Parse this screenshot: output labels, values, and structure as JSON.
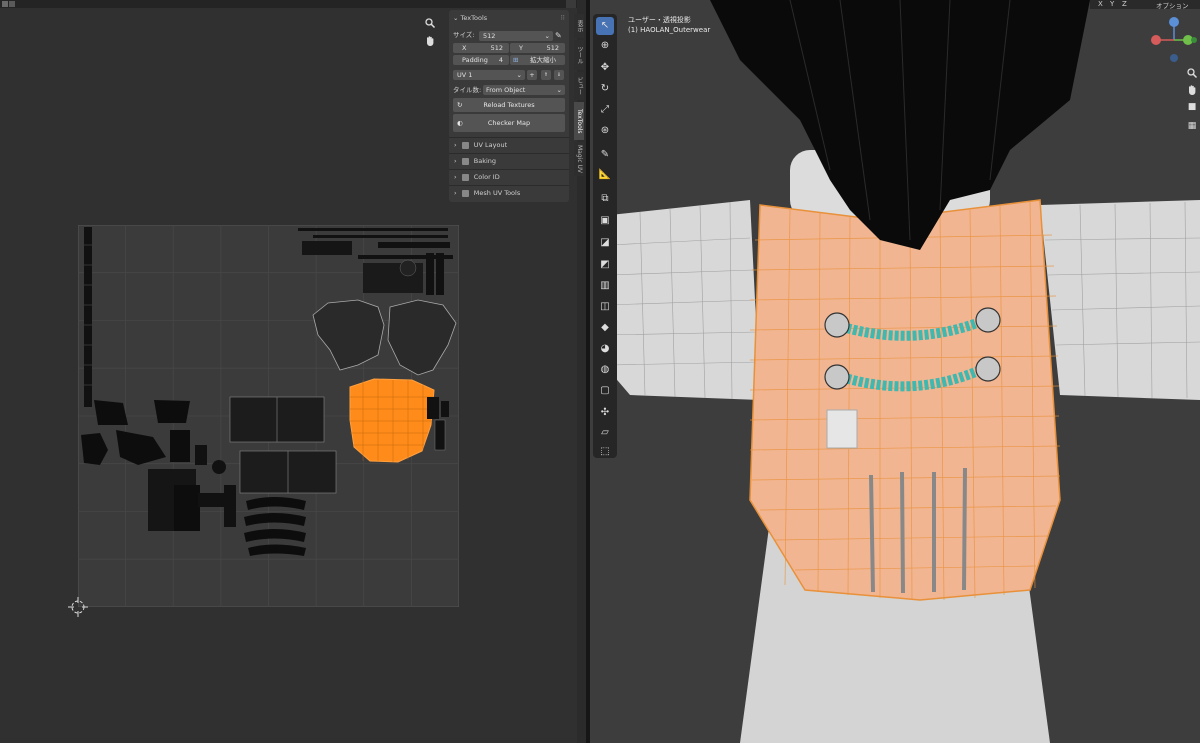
{
  "uv_editor": {
    "icons": {
      "zoom": "magnifier-icon",
      "pan": "hand-icon",
      "cursor": "2d-cursor-icon"
    }
  },
  "textools": {
    "header": "TexTools",
    "size_label": "サイズ:",
    "size_value": "512",
    "x_label": "X",
    "x_value": "512",
    "y_label": "Y",
    "y_value": "512",
    "padding_label": "Padding",
    "padding_value": "4",
    "scale_label": "拡大縮小",
    "uv_map_value": "UV 1",
    "tile_label": "タイル数:",
    "tile_value": "From Object",
    "reload_label": "Reload Textures",
    "checker_label": "Checker Map",
    "sections": [
      "UV Layout",
      "Baking",
      "Color ID",
      "Mesh UV Tools"
    ]
  },
  "sidebar_tabs": [
    "表示",
    "ツール",
    "ビュー",
    "TexTools",
    "Magic UV"
  ],
  "viewport": {
    "view_name": "ユーザー・透視投影",
    "object_name": "(1) HAOLAN_Outerwear",
    "axis_x": "X",
    "axis_y": "Y",
    "axis_z": "Z",
    "options_label": "オプション"
  },
  "colors": {
    "accent": "#4772b3",
    "selection_orange": "#ff8c1a",
    "mesh_orange_wire": "#e8913a",
    "braid_cyan": "#3fb8b0"
  }
}
